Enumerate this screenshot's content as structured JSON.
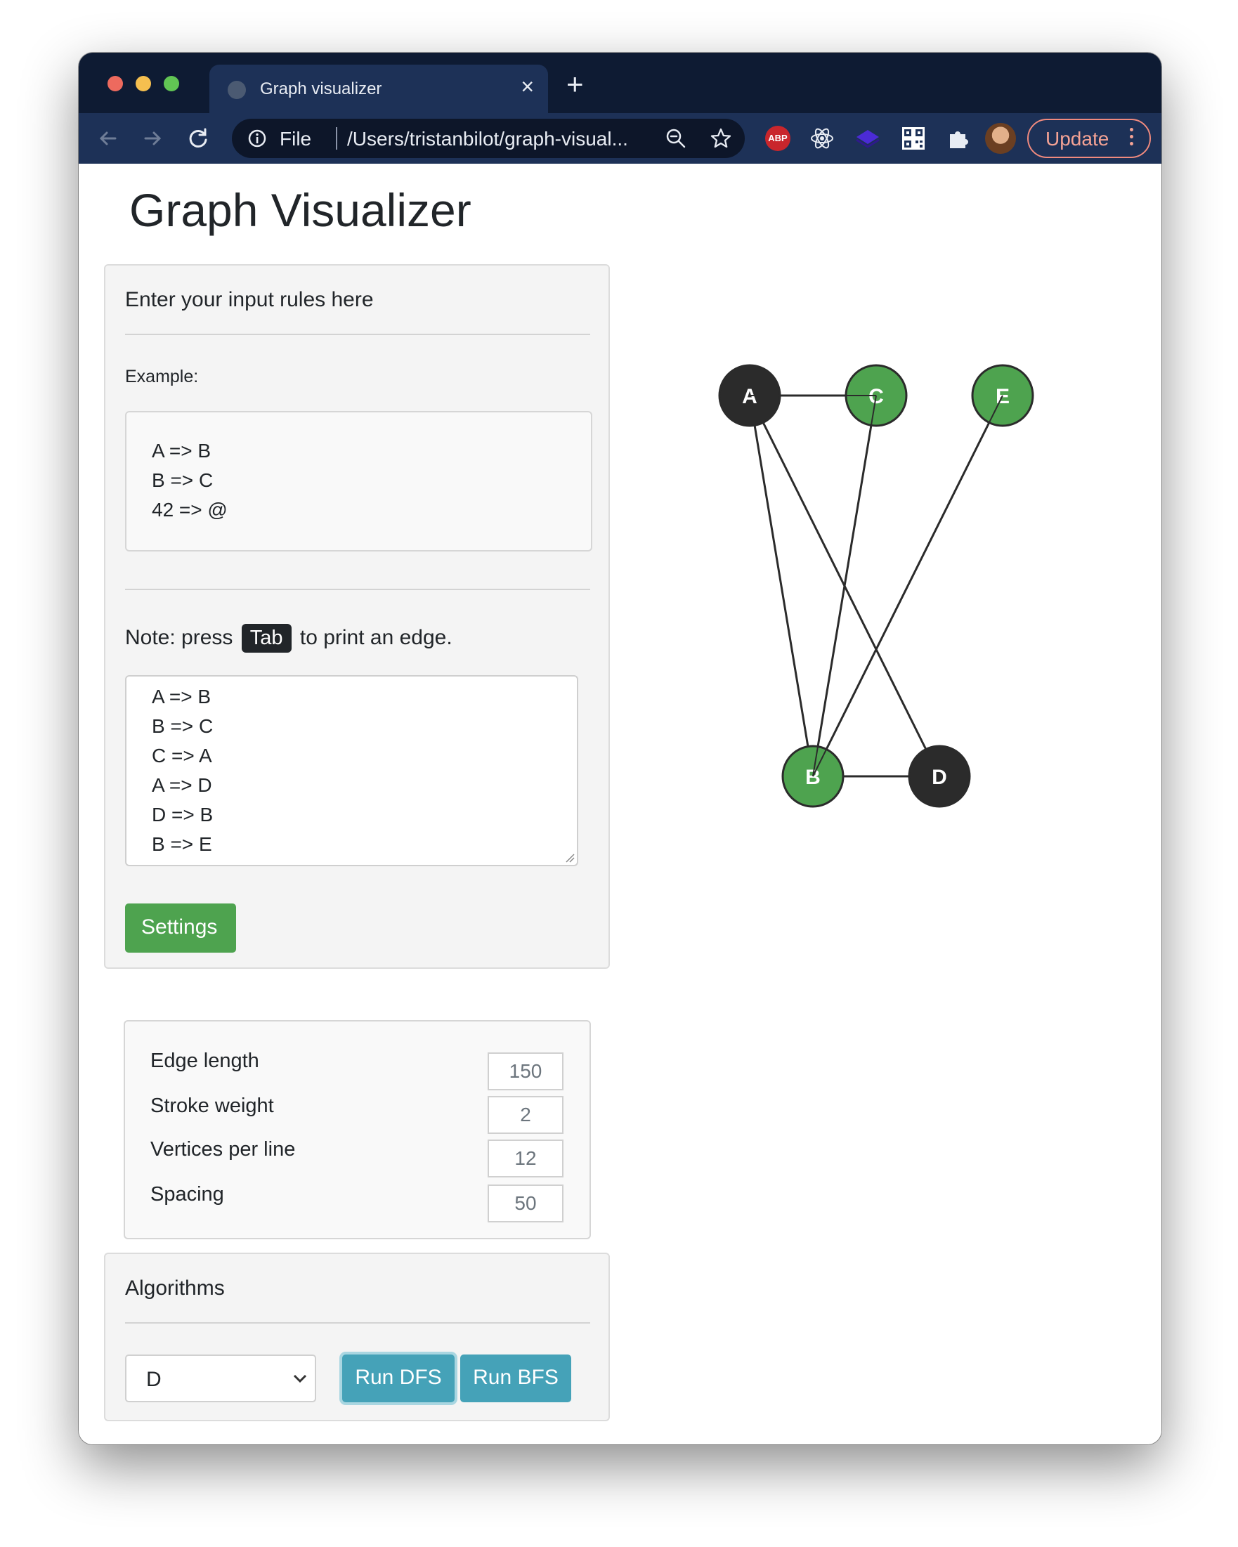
{
  "browser": {
    "tab_title": "Graph visualizer",
    "tab_close": "×",
    "new_tab": "+",
    "address_scheme": "File",
    "address_url": "/Users/tristanbilot/graph-visual...",
    "extension_abp": "ABP",
    "update_label": "Update"
  },
  "page": {
    "title": "Graph Visualizer"
  },
  "input_card": {
    "heading": "Enter your input rules here",
    "example_label": "Example:",
    "example_lines": [
      "A => B",
      "B => C",
      "42 => @"
    ],
    "note_prefix": "Note: press",
    "note_key": "Tab",
    "note_suffix": "to print an edge.",
    "rules_lines": [
      "A => B",
      "B => C",
      "C => A",
      "A => D",
      "D => B",
      "B => E"
    ],
    "settings_button": "Settings",
    "settings": [
      {
        "label": "Edge length",
        "value": "150"
      },
      {
        "label": "Stroke weight",
        "value": "2"
      },
      {
        "label": "Vertices per line",
        "value": "12"
      },
      {
        "label": "Spacing",
        "value": "50"
      }
    ]
  },
  "algorithms_card": {
    "heading": "Algorithms",
    "selected_vertex": "D",
    "run_dfs": "Run DFS",
    "run_bfs": "Run BFS"
  },
  "graph": {
    "colors": {
      "visited": "#4ea34f",
      "unvisited": "#2b2b2b",
      "edge": "#2b2b2b",
      "label": "#ffffff"
    },
    "nodes": [
      {
        "id": "A",
        "state": "unvisited"
      },
      {
        "id": "C",
        "state": "visited"
      },
      {
        "id": "E",
        "state": "visited"
      },
      {
        "id": "B",
        "state": "visited"
      },
      {
        "id": "D",
        "state": "unvisited"
      }
    ],
    "edges": [
      [
        "A",
        "B"
      ],
      [
        "B",
        "C"
      ],
      [
        "C",
        "A"
      ],
      [
        "A",
        "D"
      ],
      [
        "D",
        "B"
      ],
      [
        "B",
        "E"
      ]
    ]
  }
}
